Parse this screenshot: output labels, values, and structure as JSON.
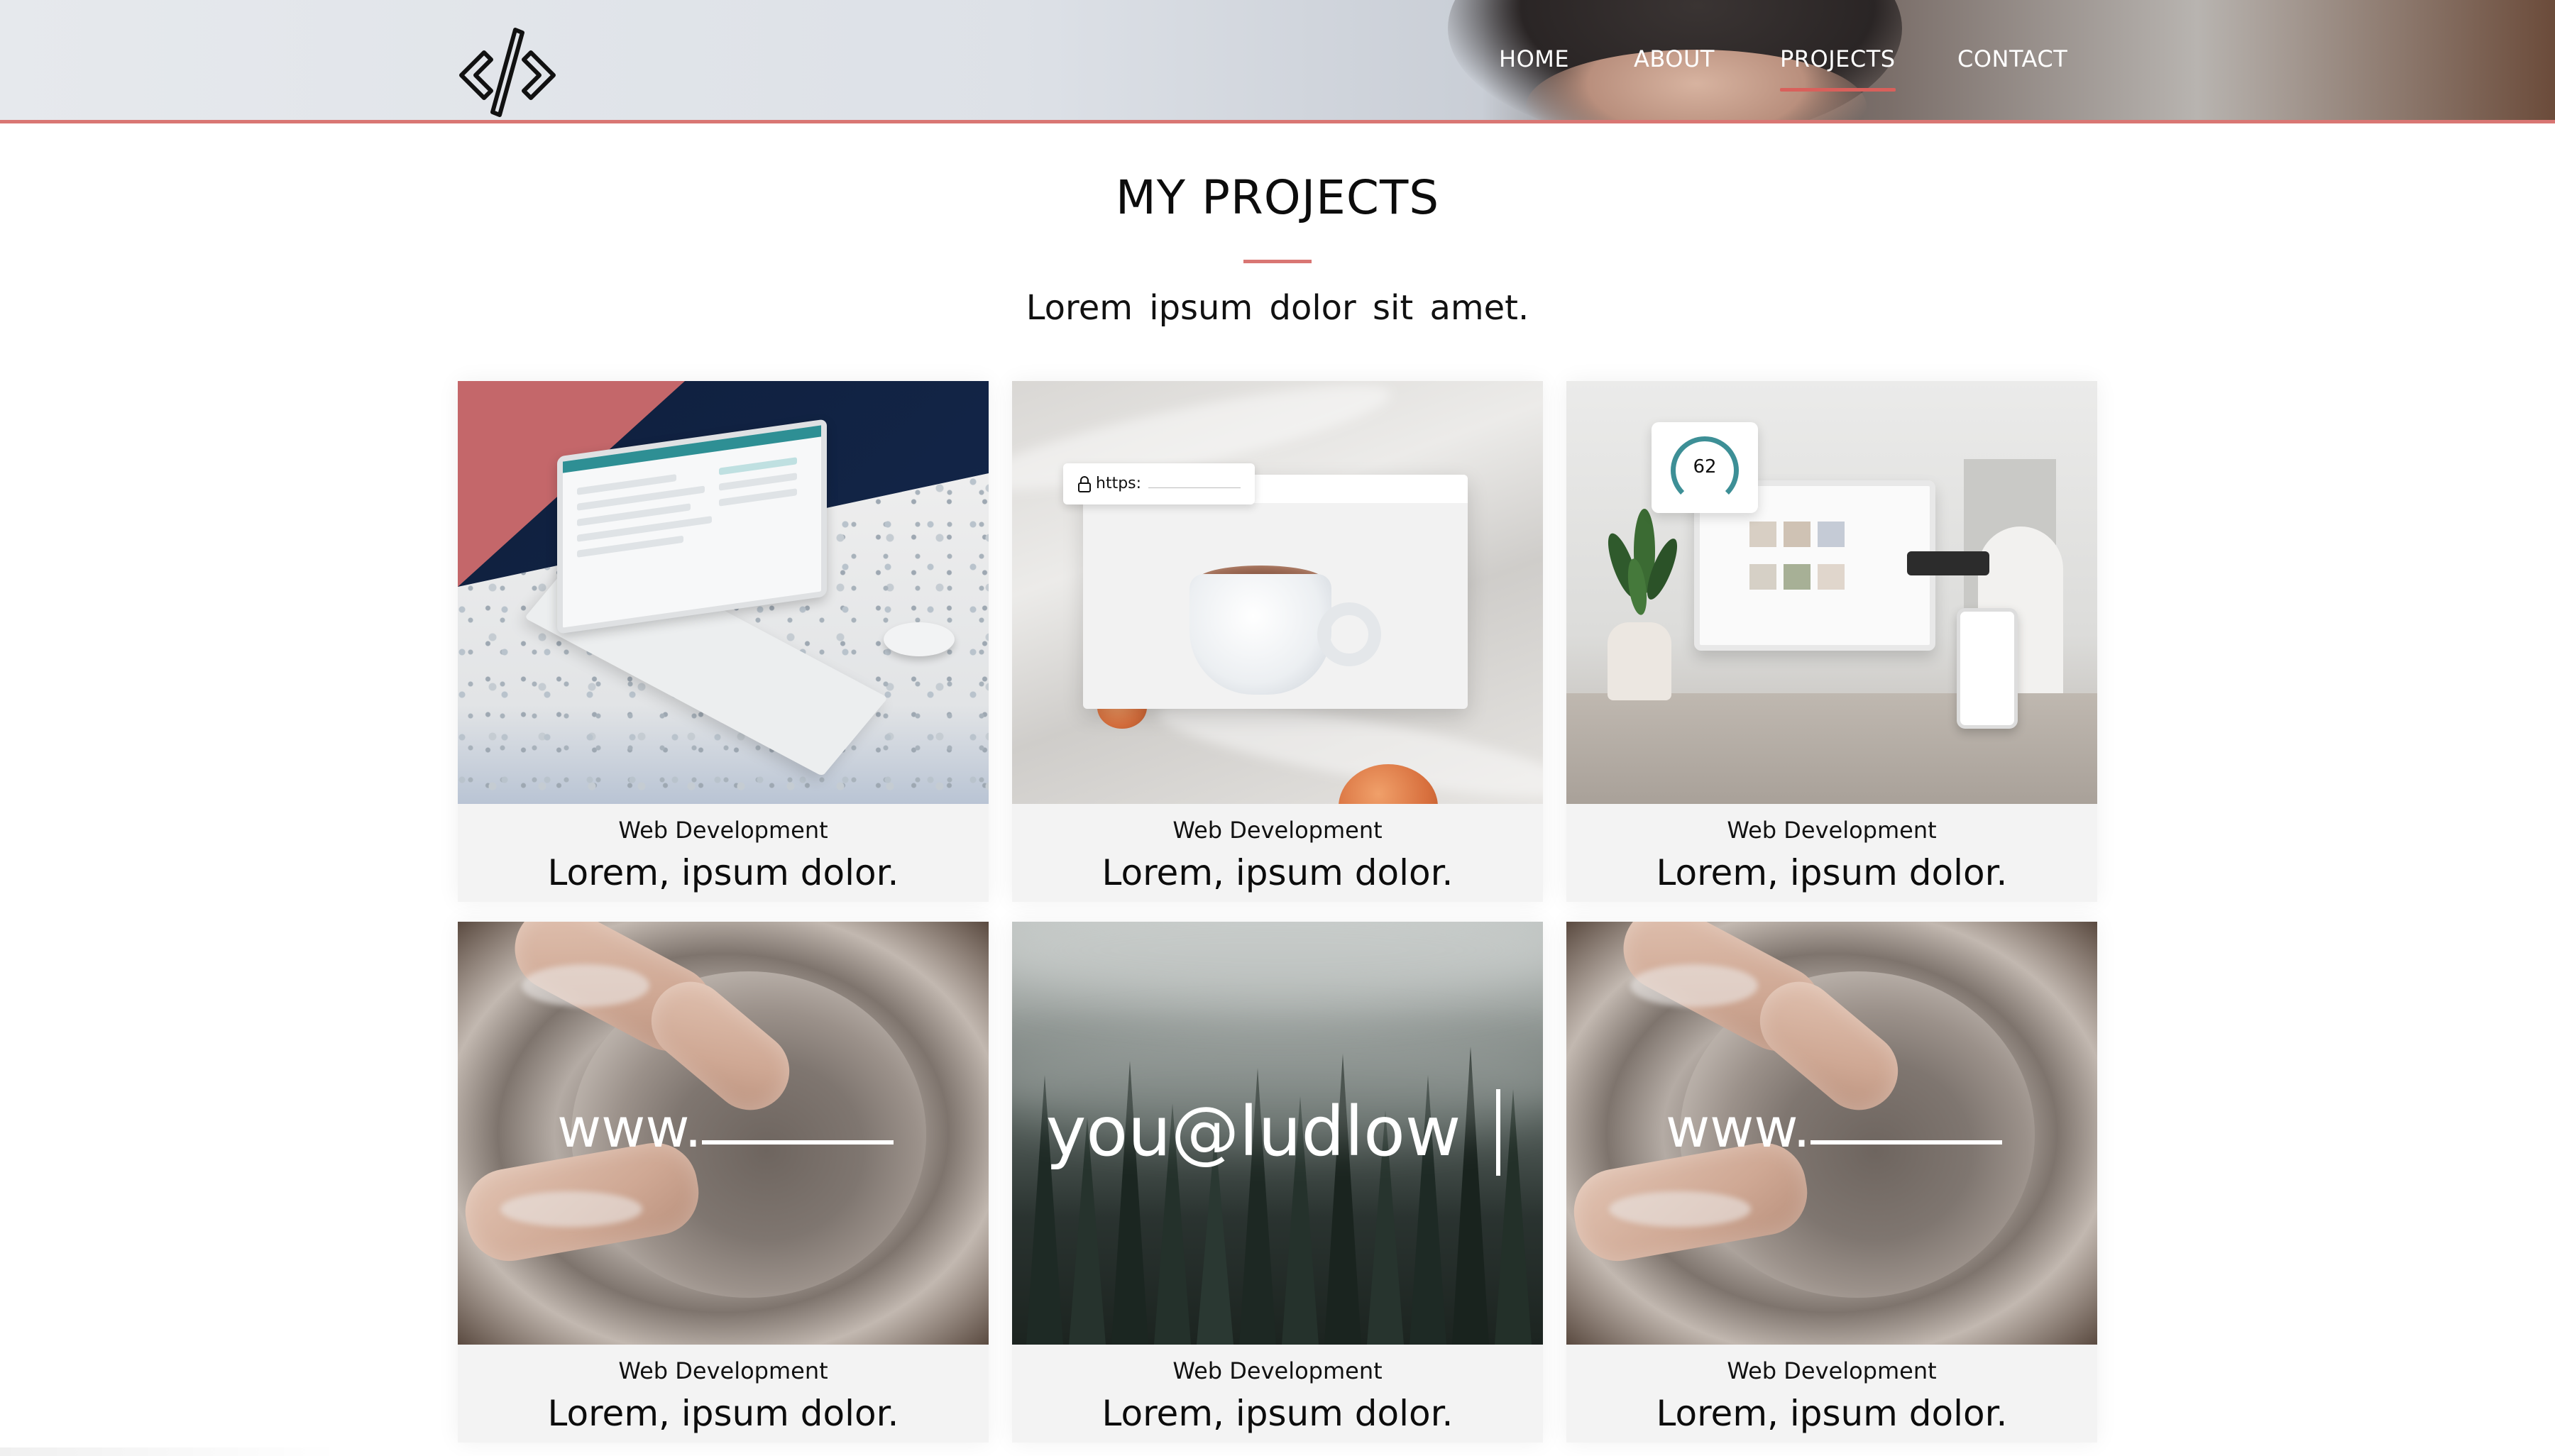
{
  "header": {
    "logo_icon": "code-brackets-icon",
    "nav": [
      {
        "label": "HOME",
        "active": false
      },
      {
        "label": "ABOUT",
        "active": false
      },
      {
        "label": "PROJECTS",
        "active": true
      },
      {
        "label": "CONTACT",
        "active": false
      }
    ]
  },
  "page": {
    "title": "MY PROJECTS",
    "subtitle": "Lorem ipsum dolor sit amet."
  },
  "colors": {
    "accent": "#d97673",
    "nav_active_underline": "#d9605b",
    "card_bg": "#f3f3f3"
  },
  "projects": [
    {
      "category": "Web Development",
      "name": "Lorem, ipsum dolor."
    },
    {
      "category": "Web Development",
      "name": "Lorem, ipsum dolor.",
      "url_text": "https:"
    },
    {
      "category": "Web Development",
      "name": "Lorem, ipsum dolor.",
      "gauge_value": "62"
    },
    {
      "category": "Web Development",
      "name": "Lorem, ipsum dolor.",
      "overlay_text": "www."
    },
    {
      "category": "Web Development",
      "name": "Lorem, ipsum dolor.",
      "overlay_text": "you@ludlow"
    },
    {
      "category": "Web Development",
      "name": "Lorem, ipsum dolor.",
      "overlay_text": "www."
    }
  ]
}
